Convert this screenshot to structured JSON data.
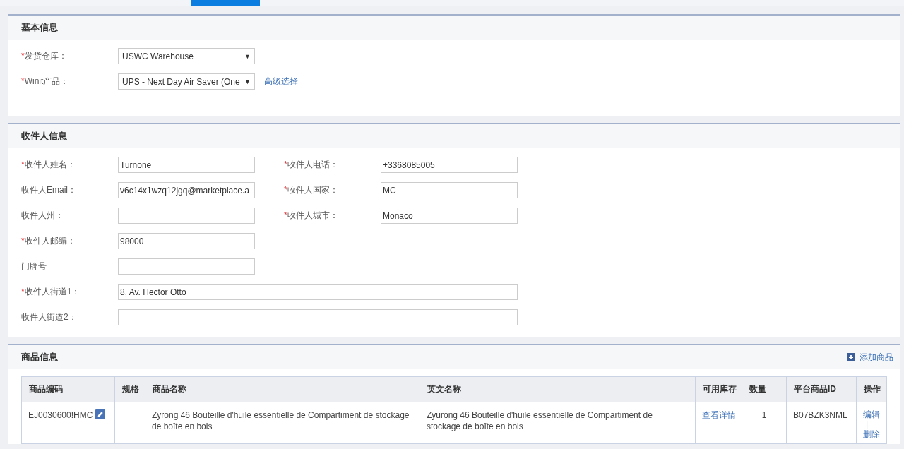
{
  "basic": {
    "title": "基本信息",
    "fields": [
      {
        "label": "发货仓库：",
        "required_mark": "*",
        "value": "USWC Warehouse",
        "caret": "▼"
      },
      {
        "label": "Winit产品：",
        "required_mark": "*",
        "value": "UPS - Next Day Air Saver (One",
        "caret": "▼",
        "link": "高级选择"
      }
    ]
  },
  "recipient": {
    "title": "收件人信息",
    "rows": [
      [
        {
          "label": "收件人姓名：",
          "required_mark": "*",
          "value": "Turnone"
        },
        {
          "label": "收件人电话：",
          "required_mark": "*",
          "value": "+3368085005"
        }
      ],
      [
        {
          "label": "收件人Email：",
          "value": "v6c14x1wzq12jgq@marketplace.a"
        },
        {
          "label": "收件人国家：",
          "required_mark": "*",
          "value": "MC"
        }
      ],
      [
        {
          "label": "收件人州："
        },
        {
          "label": "收件人城市：",
          "required_mark": "*",
          "value": "Monaco"
        }
      ],
      [
        {
          "label": "收件人邮编：",
          "required_mark": "*",
          "value": "98000"
        }
      ],
      [
        {
          "label": "门牌号"
        }
      ],
      [
        {
          "label": "收件人街道1：",
          "required_mark": "*",
          "value": "8, Av. Hector Otto",
          "wide": true
        }
      ],
      [
        {
          "label": "收件人街道2：",
          "wide": true
        }
      ]
    ]
  },
  "products": {
    "title": "商品信息",
    "add_button": "添加商品",
    "columns": [
      "商品编码",
      "规格",
      "商品名称",
      "英文名称",
      "可用库存",
      "数量",
      "平台商品ID",
      "操作"
    ],
    "rows": [
      {
        "code": "EJ0030600!HMC",
        "name": "Zyrong 46 Bouteille d'huile essentielle de Compartiment de stockage de boîte en bois",
        "english_name": "Zyurong 46 Bouteille d'huile essentielle de Compartiment de stockage de boîte en bois",
        "stock": "查看详情",
        "quantity": "1",
        "platform_id": "B07BZK3NML",
        "actions": [
          "编辑",
          "|",
          "删除"
        ]
      }
    ]
  }
}
